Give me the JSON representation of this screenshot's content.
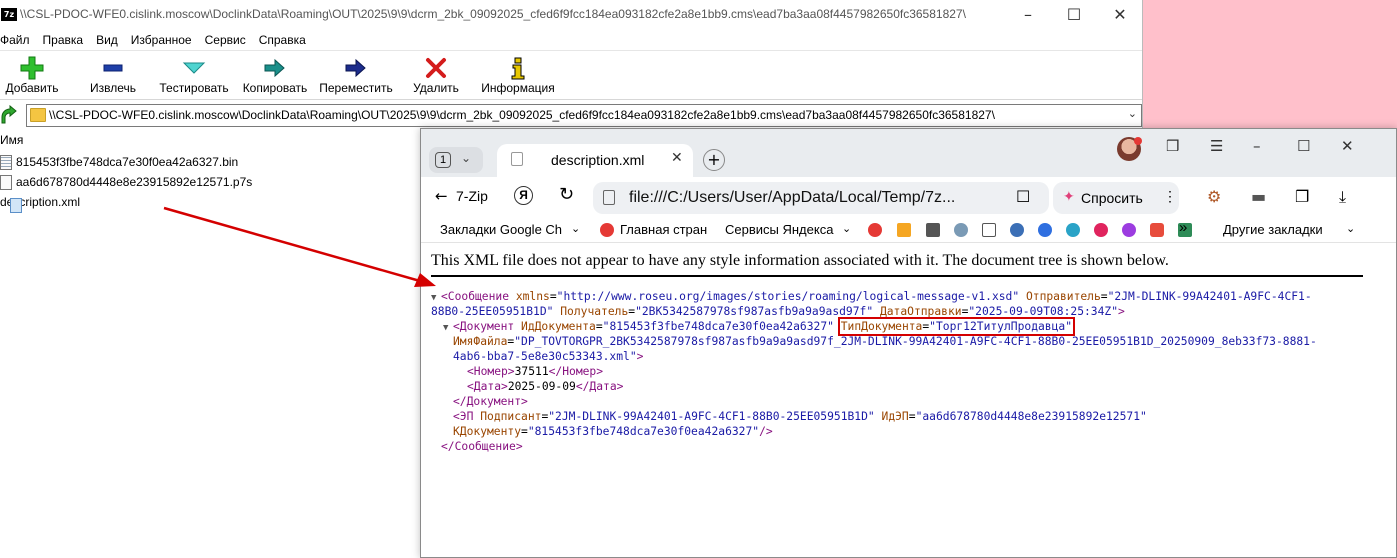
{
  "zip": {
    "title": "\\\\CSL-PDOC-WFE0.cislink.moscow\\DoclinkData\\Roaming\\OUT\\2025\\9\\9\\dcrm_2bk_09092025_cfed6f9fcc184ea093182cfe2a8e1bb9.cms\\ead7ba3aa08f4457982650fc36581827\\",
    "app_icon": "7z",
    "menu": [
      "Файл",
      "Правка",
      "Вид",
      "Избранное",
      "Сервис",
      "Справка"
    ],
    "toolbar": {
      "add": "Добавить",
      "extract": "Извлечь",
      "test": "Тестировать",
      "copy": "Копировать",
      "move": "Переместить",
      "delete": "Удалить",
      "info": "Информация"
    },
    "address": "\\\\CSL-PDOC-WFE0.cislink.moscow\\DoclinkData\\Roaming\\OUT\\2025\\9\\9\\dcrm_2bk_09092025_cfed6f9fcc184ea093182cfe2a8e1bb9.cms\\ead7ba3aa08f4457982650fc36581827\\",
    "column_name": "Имя",
    "files": [
      {
        "name": "815453f3fbe748dca7e30f0ea42a6327.bin",
        "type": "bin"
      },
      {
        "name": "aa6d678780d4448e8e23915892e12571.p7s",
        "type": "file"
      },
      {
        "name": "description.xml",
        "type": "xml"
      }
    ]
  },
  "browser": {
    "tab_count": "1",
    "tab_title": "description.xml",
    "back_label": "7-Zip",
    "url": "file:///C:/Users/User/AppData/Local/Temp/7z...",
    "ask_label": "Спросить",
    "bookmarks": {
      "google": "Закладки Google Ch",
      "main": "Главная стран",
      "yandex_services": "Сервисы Яндекса",
      "more": "»",
      "other": "Другие закладки"
    },
    "xml_notice": "This XML file does not appear to have any style information associated with it. The document tree is shown below.",
    "xml": {
      "l1_tag": "<Сообщение",
      "l1_a1": "xmlns",
      "l1_v1": "\"http://www.roseu.org/images/stories/roaming/logical-message-v1.xsd\"",
      "l1_a2": "Отправитель",
      "l1_v2": "\"2JM-DLINK-99A42401-A9FC-4CF1-",
      "l2_v2b": "88B0-25EE05951B1D\"",
      "l2_a3": "Получатель",
      "l2_v3": "\"2BK5342587978sf987asfb9a9a9asd97f\"",
      "l2_a4": "ДатаОтправки",
      "l2_v4": "\"2025-09-09T08:25:34Z\"",
      "l2_end": ">",
      "l3_tag": "<Документ",
      "l3_a1": "ИдДокумента",
      "l3_v1": "\"815453f3fbe748dca7e30f0ea42a6327\"",
      "l3_a2": "ТипДокумента",
      "l3_v2": "\"Торг12ТитулПродавца\"",
      "l4_a": "ИмяФайла",
      "l4_v": "\"DP_TOVTORGPR_2BK5342587978sf987asfb9a9a9asd97f_2JM-DLINK-99A42401-A9FC-4CF1-88B0-25EE05951B1D_20250909_8eb33f73-8881-",
      "l5_v": "4ab6-bba7-5e8e30c53343.xml\"",
      "l5_end": ">",
      "l6_open": "<Номер>",
      "l6_val": "37511",
      "l6_close": "</Номер>",
      "l7_open": "<Дата>",
      "l7_val": "2025-09-09",
      "l7_close": "</Дата>",
      "l8": "</Документ>",
      "l9_tag": "<ЭП",
      "l9_a1": "Подписант",
      "l9_v1": "\"2JM-DLINK-99A42401-A9FC-4CF1-88B0-25EE05951B1D\"",
      "l9_a2": "ИдЭП",
      "l9_v2": "\"aa6d678780d4448e8e23915892e12571\"",
      "l10_a": "КДокументу",
      "l10_v": "\"815453f3fbe748dca7e30f0ea42a6327\"",
      "l10_end": "/>",
      "l11": "</Сообщение>"
    }
  },
  "colors": {
    "desktop": "#ffc0cb",
    "annotation": "#d40000",
    "xml_tag": "#881280",
    "xml_attr": "#994500",
    "xml_value": "#1a1aa6"
  }
}
